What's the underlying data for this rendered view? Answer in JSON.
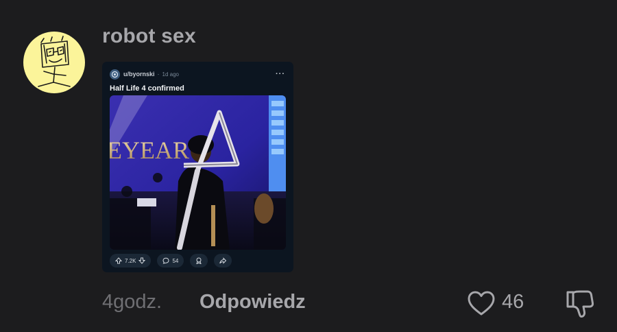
{
  "comment": {
    "author": "robot sex",
    "timestamp": "4godz.",
    "reply_label": "Odpowiedz",
    "like_count": "46",
    "avatar_icon": "stick-figure-face-drawing",
    "avatar_bg": "#fbf49a"
  },
  "embed": {
    "author": "u/byornski",
    "separator": "·",
    "age": "1d ago",
    "more_label": "···",
    "title": "Half Life 4 confirmed",
    "media_text": "EYEAR",
    "upvotes": "7.2K",
    "comments": "54"
  }
}
